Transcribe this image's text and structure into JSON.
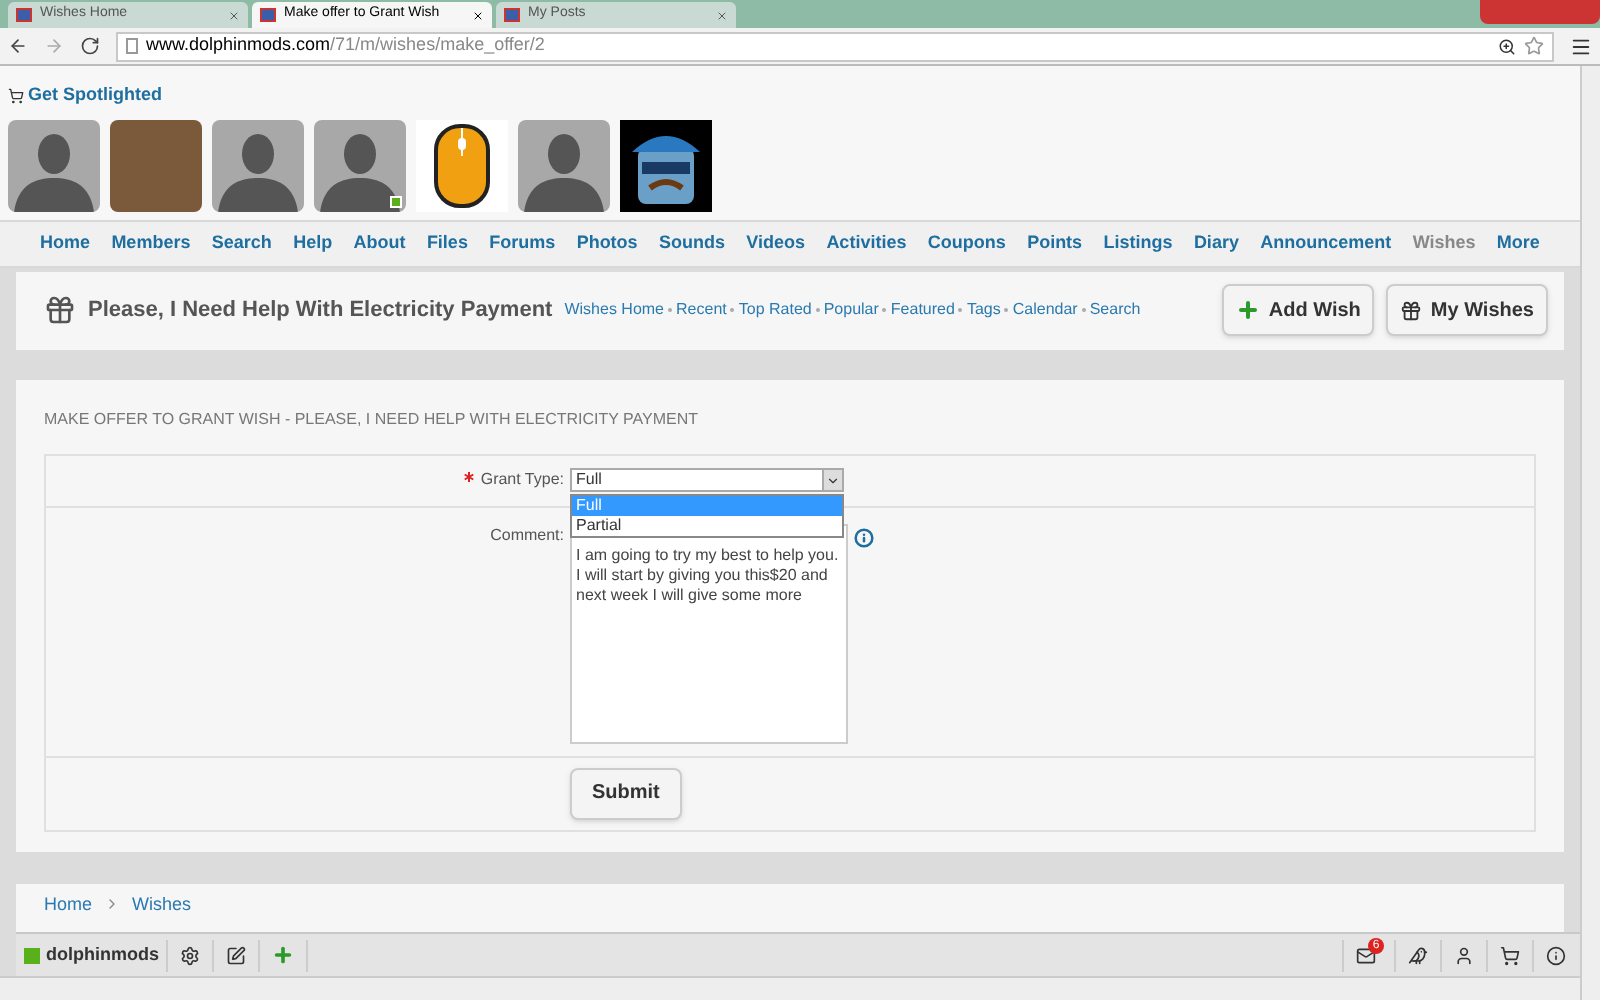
{
  "browser": {
    "tabs": [
      {
        "title": "Wishes Home",
        "selected": false
      },
      {
        "title": "Make offer to Grant Wish",
        "selected": true
      },
      {
        "title": "My Posts",
        "selected": false
      }
    ],
    "address": {
      "domain": "www.dolphinmods.com",
      "path": "/71/m/wishes/make_offer/2"
    }
  },
  "spotlight": {
    "label": "Get Spotlighted",
    "avatars": [
      {
        "kind": "silhouette",
        "online": false
      },
      {
        "kind": "photo",
        "online": false
      },
      {
        "kind": "silhouette",
        "online": false
      },
      {
        "kind": "silhouette",
        "online": true
      },
      {
        "kind": "mouse",
        "online": false
      },
      {
        "kind": "silhouette",
        "online": false
      },
      {
        "kind": "cartoon",
        "online": false
      }
    ]
  },
  "nav": [
    {
      "label": "Home",
      "selected": false
    },
    {
      "label": "Members",
      "selected": false
    },
    {
      "label": "Search",
      "selected": false
    },
    {
      "label": "Help",
      "selected": false
    },
    {
      "label": "About",
      "selected": false
    },
    {
      "label": "Files",
      "selected": false
    },
    {
      "label": "Forums",
      "selected": false
    },
    {
      "label": "Photos",
      "selected": false
    },
    {
      "label": "Sounds",
      "selected": false
    },
    {
      "label": "Videos",
      "selected": false
    },
    {
      "label": "Activities",
      "selected": false
    },
    {
      "label": "Coupons",
      "selected": false
    },
    {
      "label": "Points",
      "selected": false
    },
    {
      "label": "Listings",
      "selected": false
    },
    {
      "label": "Diary",
      "selected": false
    },
    {
      "label": "Announcement",
      "selected": false
    },
    {
      "label": "Wishes",
      "selected": true
    },
    {
      "label": "More",
      "selected": false
    }
  ],
  "header": {
    "title": "Please, I Need Help With Electricity Payment",
    "links": [
      "Wishes Home",
      "Recent",
      "Top Rated",
      "Popular",
      "Featured",
      "Tags",
      "Calendar",
      "Search"
    ],
    "buttons": [
      {
        "kind": "add",
        "label": "Add Wish"
      },
      {
        "kind": "gift",
        "label": "My Wishes"
      }
    ]
  },
  "form": {
    "heading": "MAKE OFFER TO GRANT WISH - PLEASE, I NEED HELP WITH ELECTRICITY PAYMENT",
    "grant_type": {
      "label": "Grant Type:",
      "required": true,
      "value": "Full",
      "expanded": true,
      "options": [
        {
          "label": "Full",
          "selected": true
        },
        {
          "label": "Partial",
          "selected": false
        }
      ]
    },
    "comment": {
      "label": "Comment:",
      "value": "I am going to try my best to help you. I will start by giving you this$20 and next week I will give some more"
    },
    "submit": "Submit"
  },
  "breadcrumb": [
    "Home",
    "Wishes"
  ],
  "toolbar": {
    "site": "dolphinmods",
    "mail_count": "6"
  }
}
